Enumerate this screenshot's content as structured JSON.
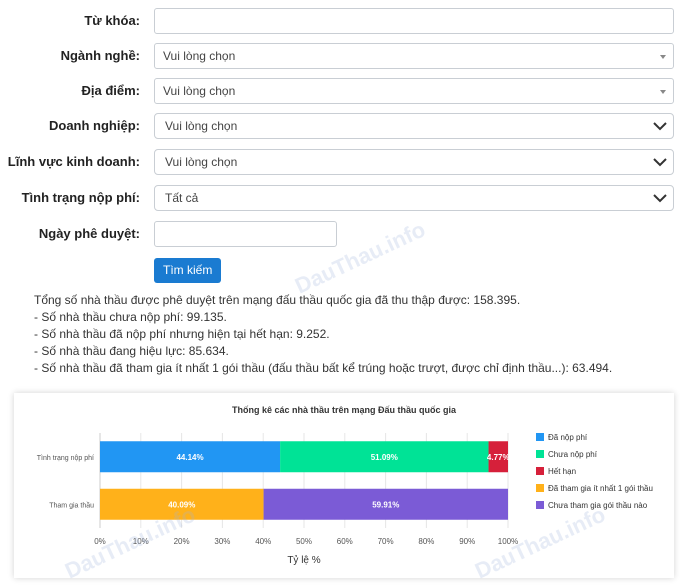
{
  "form": {
    "keyword": {
      "label": "Từ khóa:",
      "value": ""
    },
    "industry": {
      "label": "Ngành nghề:",
      "value": "Vui lòng chọn"
    },
    "location": {
      "label": "Địa điểm:",
      "value": "Vui lòng chọn"
    },
    "business": {
      "label": "Doanh nghiệp:",
      "value": "Vui lòng chọn"
    },
    "field": {
      "label": "Lĩnh vực kinh doanh:",
      "value": "Vui lòng chọn"
    },
    "fee_status": {
      "label": "Tình trạng nộp phí:",
      "value": "Tất cả"
    },
    "approval_date": {
      "label": "Ngày phê duyệt:",
      "value": ""
    },
    "search_button": "Tìm kiếm"
  },
  "stats": {
    "total": "Tổng số nhà thầu được phê duyệt trên mạng đấu thầu quốc gia đã thu thập được: 158.395.",
    "unpaid": "- Số nhà thầu chưa nộp phí: 99.135.",
    "expired": "- Số nhà thầu đã nộp phí nhưng hiện tại hết hạn: 9.252.",
    "valid": "- Số nhà thầu đang hiệu lực: 85.634.",
    "participated": "- Số nhà thầu đã tham gia ít nhất 1 gói thầu (đấu thầu bất kể trúng hoặc trượt, được chỉ định thầu...): 63.494."
  },
  "watermarks": [
    "DauThau.info",
    "DauThau.info",
    "DauThau.info"
  ],
  "chart_data": {
    "type": "bar",
    "orientation": "horizontal",
    "stacked": true,
    "title": "Thống kê các nhà thầu trên mạng Đấu thầu quốc gia",
    "xlabel": "Tỷ lệ %",
    "ylabel": "",
    "xlim": [
      0,
      100
    ],
    "xticks": [
      "0%",
      "10%",
      "20%",
      "30%",
      "40%",
      "50%",
      "60%",
      "70%",
      "80%",
      "90%",
      "100%"
    ],
    "categories": [
      "Tình trạng nộp phí",
      "Tham gia thầu"
    ],
    "grid": true,
    "legend_position": "right",
    "series": [
      {
        "name": "Đã nộp phí",
        "color": "#2196f3",
        "values": [
          44.14,
          0
        ],
        "labels": [
          "44.14%",
          ""
        ]
      },
      {
        "name": "Chưa nộp phí",
        "color": "#00e396",
        "values": [
          51.09,
          0
        ],
        "labels": [
          "51.09%",
          ""
        ]
      },
      {
        "name": "Hết hạn",
        "color": "#d6203a",
        "values": [
          4.77,
          0
        ],
        "labels": [
          "4.77%",
          ""
        ]
      },
      {
        "name": "Đã tham gia ít nhất 1 gói thầu",
        "color": "#ffb11a",
        "values": [
          0,
          40.09
        ],
        "labels": [
          "",
          "40.09%"
        ]
      },
      {
        "name": "Chưa tham gia gói thầu nào",
        "color": "#7b5bd6",
        "values": [
          0,
          59.91
        ],
        "labels": [
          "",
          "59.91%"
        ]
      }
    ]
  }
}
